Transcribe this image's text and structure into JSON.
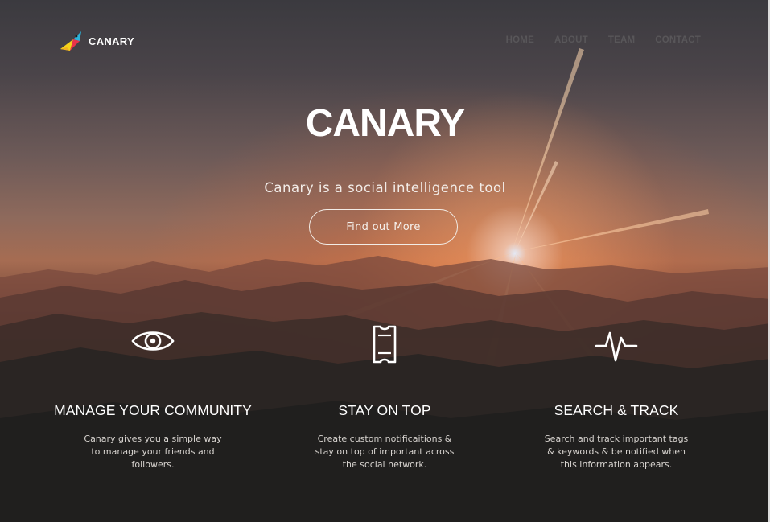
{
  "brand": {
    "name": "CANARY",
    "logo_icon": "canary-bird-icon"
  },
  "nav": {
    "items": [
      {
        "label": "HOME"
      },
      {
        "label": "ABOUT"
      },
      {
        "label": "TEAM"
      },
      {
        "label": "CONTACT"
      }
    ]
  },
  "hero": {
    "title": "CANARY",
    "subtitle": "Canary is a social intelligence tool",
    "cta_label": "Find out More"
  },
  "features": [
    {
      "icon": "eye-icon",
      "title": "MANAGE YOUR COMMUNITY",
      "text": "Canary gives you a simple way to manage your friends and followers."
    },
    {
      "icon": "ticket-icon",
      "title": "STAY ON TOP",
      "text": "Create custom notificaitions & stay on top of important across the social network."
    },
    {
      "icon": "pulse-icon",
      "title": "SEARCH & TRACK",
      "text": "Search and track important tags & keywords & be notified when this information appears."
    }
  ],
  "colors": {
    "text_primary": "#ffffff",
    "nav_link": "#585659",
    "logo_yellow": "#f5d21a",
    "logo_blue": "#2bb3d9",
    "logo_red": "#e8334a"
  }
}
